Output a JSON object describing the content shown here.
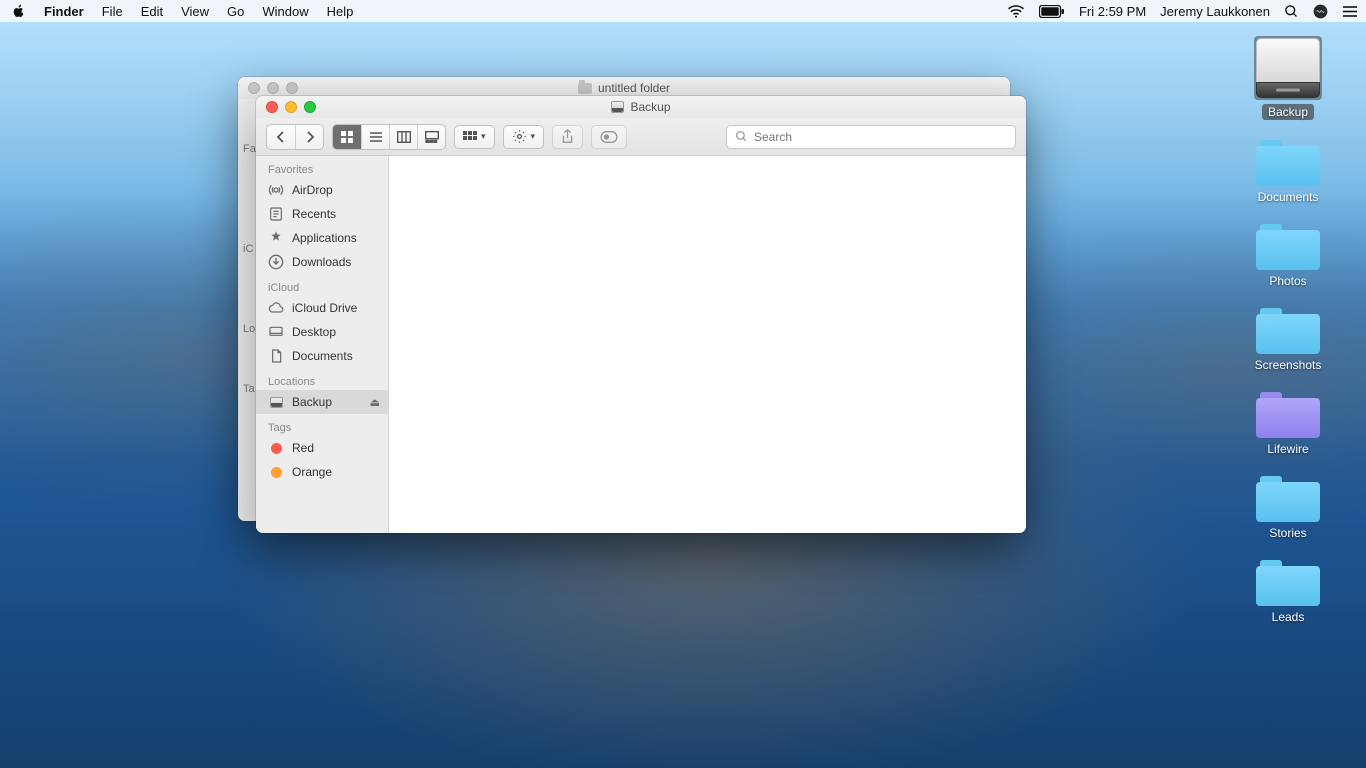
{
  "menubar": {
    "app": "Finder",
    "items": [
      "File",
      "Edit",
      "View",
      "Go",
      "Window",
      "Help"
    ],
    "clock": "Fri 2:59 PM",
    "user": "Jeremy Laukkonen"
  },
  "desktop_icons": [
    {
      "name": "Backup",
      "kind": "drive",
      "selected": true
    },
    {
      "name": "Documents",
      "kind": "folder",
      "color": "blue"
    },
    {
      "name": "Photos",
      "kind": "folder",
      "color": "blue"
    },
    {
      "name": "Screenshots",
      "kind": "folder",
      "color": "blue"
    },
    {
      "name": "Lifewire",
      "kind": "folder",
      "color": "purple"
    },
    {
      "name": "Stories",
      "kind": "folder",
      "color": "blue"
    },
    {
      "name": "Leads",
      "kind": "folder",
      "color": "blue"
    }
  ],
  "back_window": {
    "title": "untitled folder",
    "side_labels": [
      "Fa",
      "iC",
      "Lo",
      "Ta"
    ]
  },
  "front_window": {
    "title": "Backup",
    "search_placeholder": "Search",
    "sidebar": {
      "favorites_header": "Favorites",
      "favorites": [
        "AirDrop",
        "Recents",
        "Applications",
        "Downloads"
      ],
      "icloud_header": "iCloud",
      "icloud": [
        "iCloud Drive",
        "Desktop",
        "Documents"
      ],
      "locations_header": "Locations",
      "locations": [
        {
          "name": "Backup",
          "selected": true,
          "ejectable": true
        }
      ],
      "tags_header": "Tags",
      "tags": [
        {
          "name": "Red",
          "color": "#ff5b4b"
        },
        {
          "name": "Orange",
          "color": "#ff9f2e"
        }
      ]
    }
  }
}
